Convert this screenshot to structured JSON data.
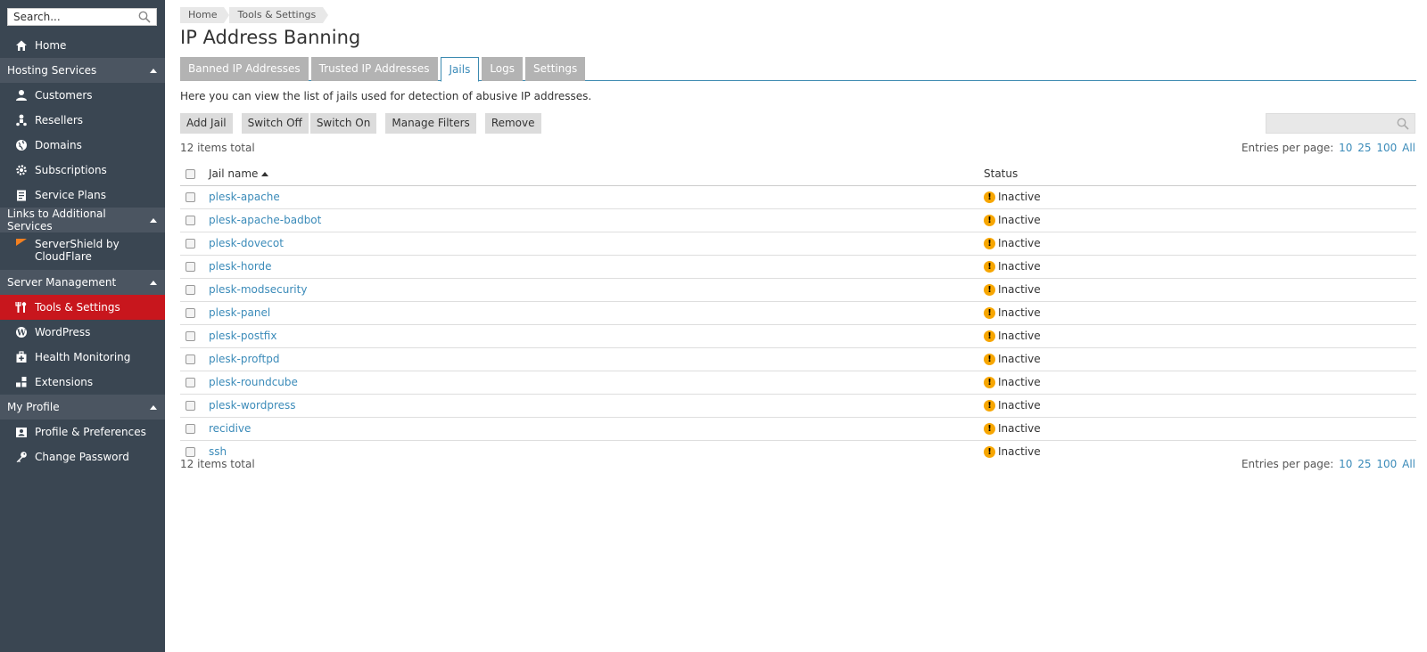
{
  "sidebar": {
    "search_placeholder": "Search...",
    "items": {
      "home": "Home",
      "customers": "Customers",
      "resellers": "Resellers",
      "domains": "Domains",
      "subscriptions": "Subscriptions",
      "service_plans": "Service Plans",
      "servershield_line1": "ServerShield by",
      "servershield_line2": "CloudFlare",
      "tools_settings": "Tools & Settings",
      "wordpress": "WordPress",
      "health_monitoring": "Health Monitoring",
      "extensions": "Extensions",
      "profile_prefs": "Profile & Preferences",
      "change_password": "Change Password"
    },
    "sections": {
      "hosting": "Hosting Services",
      "links": "Links to Additional Services",
      "server": "Server Management",
      "profile": "My Profile"
    },
    "active_color": "#c8161d"
  },
  "breadcrumb": [
    "Home",
    "Tools & Settings"
  ],
  "page_title": "IP Address Banning",
  "tabs": [
    "Banned IP Addresses",
    "Trusted IP Addresses",
    "Jails",
    "Logs",
    "Settings"
  ],
  "active_tab": "Jails",
  "hint": "Here you can view the list of jails used for detection of abusive IP addresses.",
  "toolbar": {
    "add_jail": "Add Jail",
    "switch_off": "Switch Off",
    "switch_on": "Switch On",
    "manage_filters": "Manage Filters",
    "remove": "Remove"
  },
  "list": {
    "total": "12 items total",
    "entries_label": "Entries per page:",
    "page_sizes": [
      "10",
      "25",
      "100",
      "All"
    ],
    "columns": {
      "name": "Jail name",
      "status": "Status"
    },
    "rows": [
      {
        "name": "plesk-apache",
        "status": "Inactive"
      },
      {
        "name": "plesk-apache-badbot",
        "status": "Inactive"
      },
      {
        "name": "plesk-dovecot",
        "status": "Inactive"
      },
      {
        "name": "plesk-horde",
        "status": "Inactive"
      },
      {
        "name": "plesk-modsecurity",
        "status": "Inactive"
      },
      {
        "name": "plesk-panel",
        "status": "Inactive"
      },
      {
        "name": "plesk-postfix",
        "status": "Inactive"
      },
      {
        "name": "plesk-proftpd",
        "status": "Inactive"
      },
      {
        "name": "plesk-roundcube",
        "status": "Inactive"
      },
      {
        "name": "plesk-wordpress",
        "status": "Inactive"
      },
      {
        "name": "recidive",
        "status": "Inactive"
      },
      {
        "name": "ssh",
        "status": "Inactive"
      }
    ],
    "status_icon": "warning-icon",
    "status_color": "#f7a600",
    "link_color": "#3b8bb9"
  }
}
